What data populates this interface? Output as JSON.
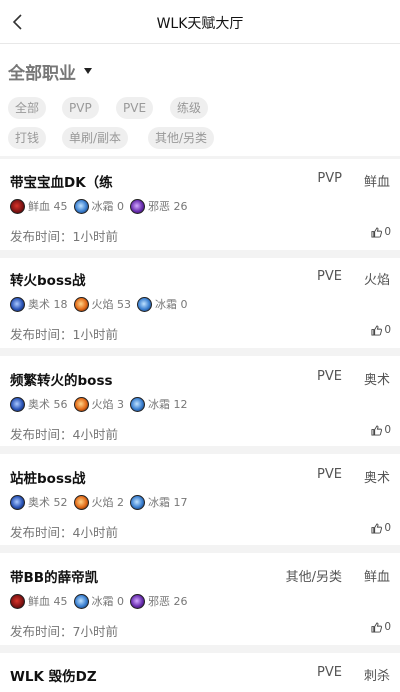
{
  "header": {
    "title": "WLK天赋大厅"
  },
  "filter": {
    "title": "全部职业",
    "chips": [
      "全部",
      "PVP",
      "PVE",
      "练级",
      "打钱",
      "单刷/副本",
      "其他/另类"
    ]
  },
  "time_label": "发布时间：",
  "cards": [
    {
      "title": "带宝宝血DK（练",
      "tag1": "PVP",
      "tag2": "鲜血",
      "specs": [
        {
          "name": "鲜血",
          "points": "45",
          "icon": "blood-icon"
        },
        {
          "name": "冰霜",
          "points": "0",
          "icon": "frost-icon"
        },
        {
          "name": "邪恶",
          "points": "26",
          "icon": "unholy-icon"
        }
      ],
      "time": "1小时前",
      "likes": "0"
    },
    {
      "title": "转火boss战",
      "tag1": "PVE",
      "tag2": "火焰",
      "specs": [
        {
          "name": "奥术",
          "points": "18",
          "icon": "arcane-icon"
        },
        {
          "name": "火焰",
          "points": "53",
          "icon": "fire-icon"
        },
        {
          "name": "冰霜",
          "points": "0",
          "icon": "frost-icon"
        }
      ],
      "time": "1小时前",
      "likes": "0"
    },
    {
      "title": "频繁转火的boss",
      "tag1": "PVE",
      "tag2": "奥术",
      "specs": [
        {
          "name": "奥术",
          "points": "56",
          "icon": "arcane-icon"
        },
        {
          "name": "火焰",
          "points": "3",
          "icon": "fire-icon"
        },
        {
          "name": "冰霜",
          "points": "12",
          "icon": "frost-icon"
        }
      ],
      "time": "4小时前",
      "likes": "0"
    },
    {
      "title": "站桩boss战",
      "tag1": "PVE",
      "tag2": "奥术",
      "specs": [
        {
          "name": "奥术",
          "points": "52",
          "icon": "arcane-icon"
        },
        {
          "name": "火焰",
          "points": "2",
          "icon": "fire-icon"
        },
        {
          "name": "冰霜",
          "points": "17",
          "icon": "frost-icon"
        }
      ],
      "time": "4小时前",
      "likes": "0"
    },
    {
      "title": "带BB的薛帝凯",
      "tag1": "其他/另类",
      "tag2": "鲜血",
      "specs": [
        {
          "name": "鲜血",
          "points": "45",
          "icon": "blood-icon"
        },
        {
          "name": "冰霜",
          "points": "0",
          "icon": "frost-icon"
        },
        {
          "name": "邪恶",
          "points": "26",
          "icon": "unholy-icon"
        }
      ],
      "time": "7小时前",
      "likes": "0"
    },
    {
      "title": "WLK 毁伤DZ",
      "tag1": "PVE",
      "tag2": "刺杀",
      "specs": [],
      "time": "",
      "likes": ""
    }
  ]
}
